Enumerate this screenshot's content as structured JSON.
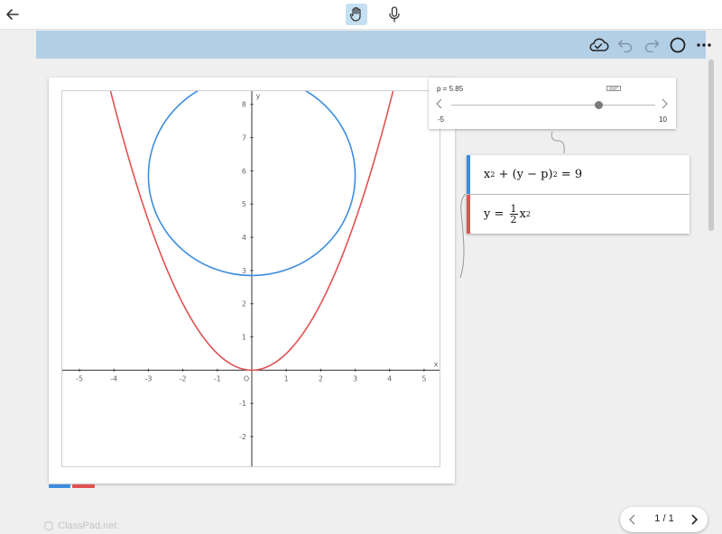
{
  "topbar": {
    "back_icon": "arrow-left-icon",
    "hand_icon": "hand-pan-icon",
    "mic_icon": "microphone-icon"
  },
  "toolbar": {
    "icons": [
      "cloud-check-icon",
      "undo-icon",
      "redo-icon",
      "circle-icon",
      "more-icon"
    ],
    "band_color": "#b3cfe6"
  },
  "slider": {
    "label": "p = 5.85",
    "min_label": "-5",
    "max_label": "10",
    "min": -5,
    "max": 10,
    "value": 5.85
  },
  "expressions": [
    {
      "color": "#3b8de0"
    },
    {
      "color": "#e05252"
    }
  ],
  "chart_data": {
    "type": "line",
    "xlabel": "x",
    "ylabel": "y",
    "origin_label": "O",
    "xlim": [
      -5.5,
      5.5
    ],
    "ylim": [
      -2.95,
      8.4
    ],
    "x_ticks": [
      "-5",
      "-4",
      "-3",
      "-2",
      "-1",
      "1",
      "2",
      "3",
      "4",
      "5"
    ],
    "y_ticks": [
      "-2",
      "-1",
      "1",
      "2",
      "3",
      "4",
      "5",
      "6",
      "7",
      "8"
    ],
    "grid": false,
    "series": [
      {
        "equation": "x^2 + (y - p)^2 = 9",
        "kind": "circle",
        "center": [
          0,
          5.85
        ],
        "radius": 3,
        "color": "#3b8de0"
      },
      {
        "equation": "y = 1/2 x^2",
        "kind": "parabola",
        "coefficient": 0.5,
        "color": "#e05252"
      }
    ]
  },
  "watermark": {
    "text": "ClassPad.net"
  },
  "pager": {
    "label": "1 / 1"
  }
}
